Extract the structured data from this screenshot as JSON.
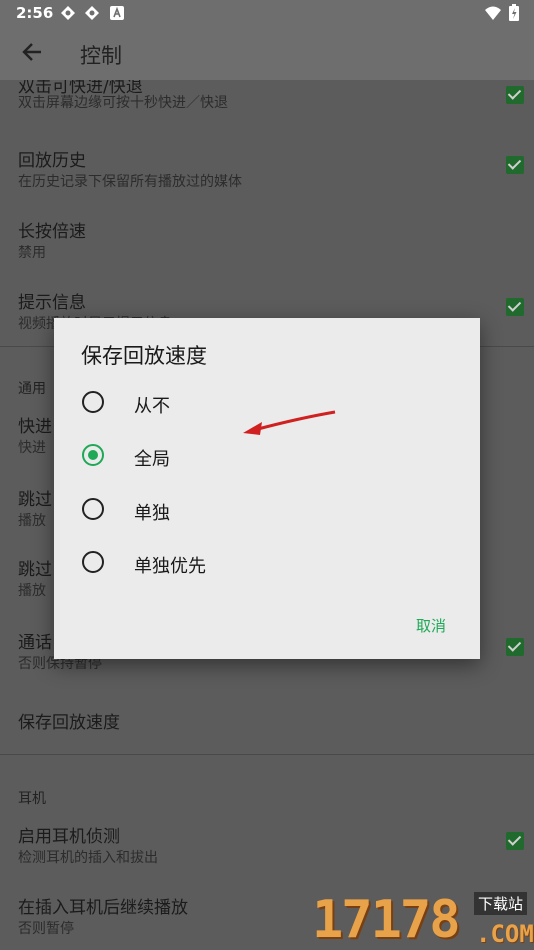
{
  "status_bar": {
    "time": "2:56"
  },
  "app_bar": {
    "title": "控制"
  },
  "settings": {
    "double_tap": {
      "title": "双击可快进/快退",
      "summary": "双击屏幕边缘可按十秒快进／快退"
    },
    "history": {
      "title": "回放历史",
      "summary": "在历史记录下保留所有播放过的媒体"
    },
    "long_press": {
      "title": "长按倍速",
      "summary": "禁用"
    },
    "hint": {
      "title": "提示信息",
      "summary": "视频播放时显示提示信息"
    },
    "general_header": "通用",
    "fast_forward": {
      "title": "快进",
      "summary": "快进"
    },
    "skip1": {
      "title": "跳过",
      "summary": "播放"
    },
    "skip2": {
      "title": "跳过",
      "summary": "播放"
    },
    "call": {
      "title": "通话",
      "summary": "否则保持暂停"
    },
    "save_speed": {
      "title": "保存回放速度"
    },
    "headset_header": "耳机",
    "headset_detect": {
      "title": "启用耳机侦测",
      "summary": "检测耳机的插入和拔出"
    },
    "resume_after_plug": {
      "title": "在插入耳机后继续播放",
      "summary": "否则暂停"
    }
  },
  "dialog": {
    "title": "保存回放速度",
    "options": [
      "从不",
      "全局",
      "单独",
      "单独优先"
    ],
    "selected_index": 1,
    "cancel": "取消"
  },
  "watermark": {
    "digits": "17178",
    "label": "下载站",
    "domain": ".COM"
  },
  "colors": {
    "accent": "#1fa857",
    "watermark": "#e8a24a"
  }
}
